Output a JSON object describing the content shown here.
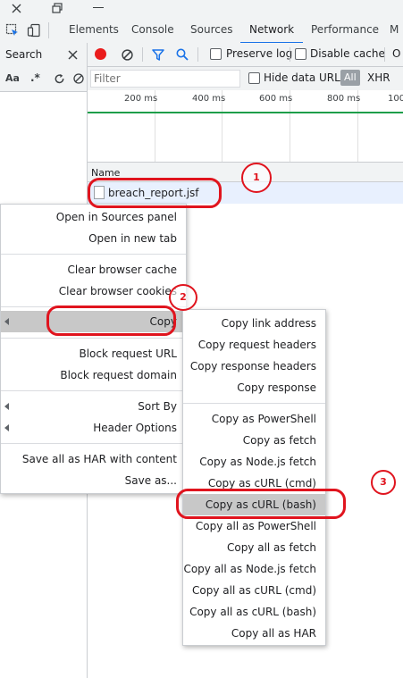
{
  "tabs": [
    {
      "label": "Elements",
      "active": false
    },
    {
      "label": "Console",
      "active": false
    },
    {
      "label": "Sources",
      "active": false
    },
    {
      "label": "Network",
      "active": true
    },
    {
      "label": "Performance",
      "active": false
    },
    {
      "label": "M",
      "active": false
    }
  ],
  "search_panel": {
    "title": "Search",
    "aa_label": "Aa",
    "regex_label": ".*"
  },
  "network_toolbar": {
    "preserve_log": "Preserve log",
    "disable_cache": "Disable cache",
    "overflow_label": "O",
    "filter_placeholder": "Filter",
    "hide_data_urls": "Hide data URLs",
    "all_label": "All",
    "xhr_label": "XHR"
  },
  "timeline": {
    "ticks": [
      "200 ms",
      "400 ms",
      "600 ms",
      "800 ms",
      "100"
    ]
  },
  "table": {
    "name_header": "Name",
    "rows": [
      {
        "name": "breach_report.jsf"
      }
    ]
  },
  "context_menu": {
    "items": [
      "Open in Sources panel",
      "Open in new tab",
      "Clear browser cache",
      "Clear browser cookies",
      "Copy",
      "Block request URL",
      "Block request domain",
      "Sort By",
      "Header Options",
      "Save all as HAR with content",
      "Save as..."
    ]
  },
  "copy_submenu": {
    "items": [
      "Copy link address",
      "Copy request headers",
      "Copy response headers",
      "Copy response",
      "Copy as PowerShell",
      "Copy as fetch",
      "Copy as Node.js fetch",
      "Copy as cURL (cmd)",
      "Copy as cURL (bash)",
      "Copy all as PowerShell",
      "Copy all as fetch",
      "Copy all as Node.js fetch",
      "Copy all as cURL (cmd)",
      "Copy all as cURL (bash)",
      "Copy all as HAR"
    ]
  },
  "annotations": [
    "1",
    "2",
    "3"
  ],
  "colors": {
    "accent": "#1a73e8",
    "record": "#ea1c1c",
    "annotation": "#e0141e",
    "timeline_bar": "#1e9e4a"
  }
}
